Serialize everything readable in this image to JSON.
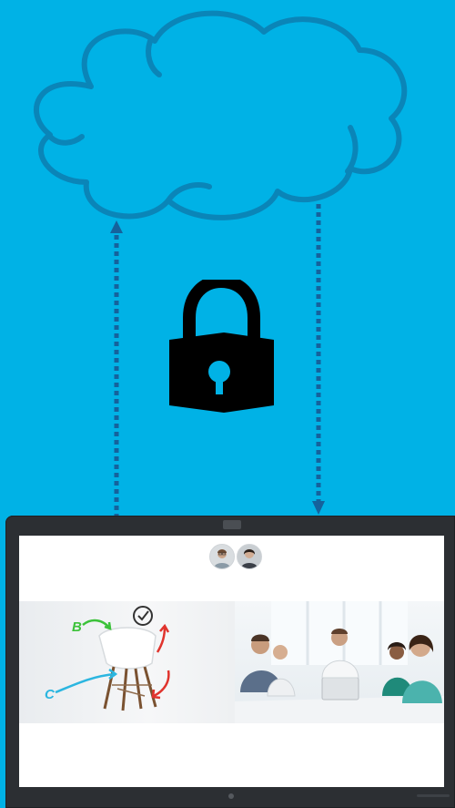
{
  "colors": {
    "background": "#00b2e6",
    "cloud_stroke": "#0a85b8",
    "arrow": "#15629c",
    "lock": "#000000",
    "device_frame": "#2c2f33",
    "screen": "#ffffff",
    "marker_green": "#3cc23a",
    "marker_blue": "#2bb6e0",
    "marker_red": "#e0342d"
  },
  "icons": {
    "cloud": "cloud-icon",
    "lock": "lock-icon",
    "arrow_up": "arrow-up-icon",
    "arrow_down": "arrow-down-icon"
  },
  "whiteboard": {
    "label_b": "B",
    "label_c": "C"
  }
}
